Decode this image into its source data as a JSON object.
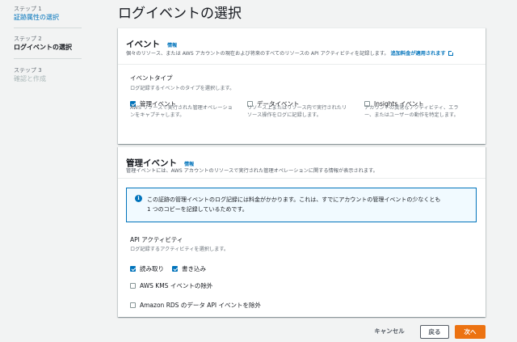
{
  "sidebar": {
    "steps": [
      {
        "num": "ステップ 1",
        "label": "証跡属性の選択",
        "state": "link"
      },
      {
        "num": "ステップ 2",
        "label": "ログイベントの選択",
        "state": "current"
      },
      {
        "num": "ステップ 3",
        "label": "確認と作成",
        "state": "disabled"
      }
    ]
  },
  "page": {
    "title": "ログイベントの選択"
  },
  "events": {
    "title": "イベント",
    "info": "情報",
    "desc": "個々のリソース、または AWS アカウントの現在および将来のすべてのリソースの API アクティビティを記録します。",
    "extra_link": "追加料金が適用されます",
    "type_label": "イベントタイプ",
    "type_desc": "ログ記録するイベントのタイプを選択します。",
    "options": [
      {
        "label": "管理イベント",
        "checked": true,
        "desc1": "AWS リソースで実行された管理オペレーショ",
        "desc2": "ンをキャプチャします。"
      },
      {
        "label": "データイベント",
        "checked": false,
        "desc1": "リソース上またはリソース内で実行されたリ",
        "desc2": "ソース操作をログに記録します。"
      },
      {
        "label": "Insights イベント",
        "checked": false,
        "desc1": "アカウントの異常なアクティビティ、エラ",
        "desc2": "ー、またはユーザーの動作を特定します。"
      }
    ]
  },
  "mgmt": {
    "title": "管理イベント",
    "info": "情報",
    "desc": "管理イベントには、AWS アカウントのリソースで実行された管理オペレーションに関する情報が表示されます。",
    "alert_line1": "この証跡の管理イベントのログ記録には料金がかかります。これは、すでにアカウントの管理イベントの少なくとも",
    "alert_line2": "1 つのコピーを記録しているためです。",
    "api_label": "API アクティビティ",
    "api_desc": "ログ記録するアクティビティを選択します。",
    "read": {
      "label": "読み取り",
      "checked": true
    },
    "write": {
      "label": "書き込み",
      "checked": true
    },
    "exclude_kms": {
      "label": "AWS KMS イベントの除外",
      "checked": false
    },
    "exclude_rds": {
      "label": "Amazon RDS のデータ API イベントを除外",
      "checked": false
    }
  },
  "footer": {
    "cancel": "キャンセル",
    "back": "戻る",
    "next": "次へ"
  },
  "colors": {
    "accent": "#0073bb",
    "primary_button": "#ec7211"
  }
}
